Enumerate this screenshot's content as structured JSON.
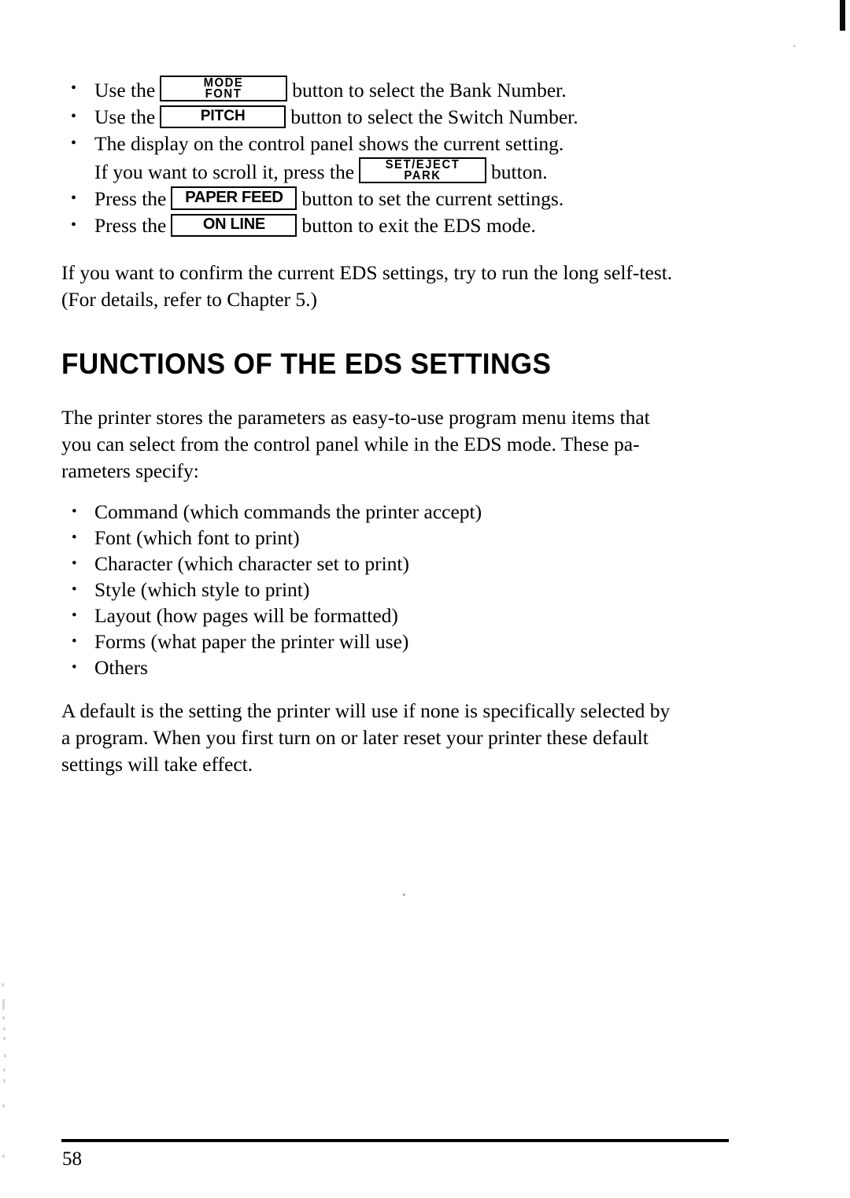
{
  "page": {
    "number": "58"
  },
  "instructions": [
    {
      "id": "bank-number",
      "lines": [
        {
          "before": "Use the",
          "button": "mode-font",
          "after": "button to select the Bank Number."
        }
      ]
    },
    {
      "id": "switch-number",
      "lines": [
        {
          "before": "Use the",
          "button": "pitch",
          "after": "button to select the Switch Number."
        }
      ]
    },
    {
      "id": "display-scroll",
      "lines": [
        {
          "before": "The display on the control panel shows the current setting.",
          "button": null,
          "after": ""
        },
        {
          "before": "If you want to scroll it, press the",
          "button": "set-eject-park",
          "after": "button."
        }
      ]
    },
    {
      "id": "set-settings",
      "lines": [
        {
          "before": "Press the",
          "button": "paper-feed",
          "after": "button to set the current settings."
        }
      ]
    },
    {
      "id": "exit-eds",
      "lines": [
        {
          "before": "Press the",
          "button": "on-line",
          "after": "button to exit the EDS mode."
        }
      ]
    }
  ],
  "buttons": {
    "mode-font": {
      "line1": "MODE",
      "line2": "FONT"
    },
    "pitch": {
      "line1": "PITCH",
      "line2": ""
    },
    "set-eject-park": {
      "line1": "SET/EJECT",
      "line2": "PARK"
    },
    "paper-feed": {
      "line1": "PAPER FEED",
      "line2": ""
    },
    "on-line": {
      "line1": "ON LINE",
      "line2": ""
    }
  },
  "confirm_paragraph": {
    "lines": [
      "If you want to confirm the current EDS settings, try to run the long self-test.",
      "(For details, refer to Chapter 5.)"
    ]
  },
  "section": {
    "title": "FUNCTIONS OF THE EDS SETTINGS"
  },
  "intro_paragraph": {
    "lines": [
      "The printer stores the parameters as easy-to-use program menu items that",
      "you can select from the control panel while in the EDS mode. These pa-",
      "rameters specify:"
    ]
  },
  "parameters": [
    "Command (which commands the printer accept)",
    "Font (which font to print)",
    "Character (which character set to print)",
    "Style (which style to print)",
    "Layout (how pages will be formatted)",
    "Forms (what paper the printer will use)",
    "Others"
  ],
  "default_paragraph": {
    "lines": [
      "A default is the setting the printer will use if none is specifically selected by",
      "a program. When you first turn on or later reset your printer these default",
      "settings will take effect."
    ]
  }
}
